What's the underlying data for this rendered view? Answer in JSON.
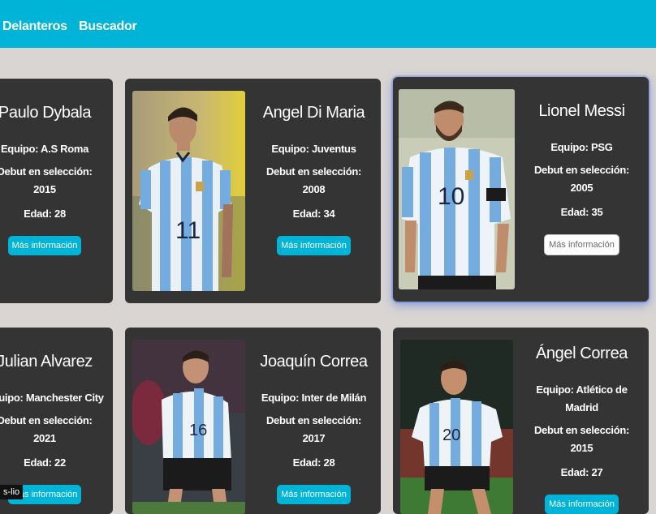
{
  "nav": {
    "links": [
      "Delanteros",
      "Buscador"
    ],
    "color": "#00b4d8"
  },
  "players": [
    {
      "name": "Paulo Dybala",
      "team": "Equipo: A.S Roma",
      "debut_label": "Debut en selección:",
      "debut_year": "2015",
      "age": "Edad: 28",
      "button": "Más información"
    },
    {
      "name": "Angel Di Maria",
      "team": "Equipo: Juventus",
      "debut_label": "Debut en selección:",
      "debut_year": "2008",
      "age": "Edad: 34",
      "button": "Más información"
    },
    {
      "name": "Lionel Messi",
      "team": "Equipo: PSG",
      "debut_label": "Debut en selección:",
      "debut_year": "2005",
      "age": "Edad: 35",
      "button": "Más información"
    },
    {
      "name": "Julian Alvarez",
      "team": "Equipo: Manchester City",
      "debut_label": "Debut en selección:",
      "debut_year": "2021",
      "age": "Edad: 22",
      "button": "Más información"
    },
    {
      "name": "Joaquín Correa",
      "team": "Equipo: Inter de Milán",
      "debut_label": "Debut en selección:",
      "debut_year": "2017",
      "age": "Edad: 28",
      "button": "Más información"
    },
    {
      "name": "Ángel Correa",
      "team_line1": "Equipo: Atlético de",
      "team_line2": "Madrid",
      "debut_label": "Debut en selección:",
      "debut_year": "2015",
      "age": "Edad: 27",
      "button": "Más información"
    }
  ],
  "jersey_numbers": [
    "11",
    "10",
    "16",
    "20"
  ],
  "corner_tip": "s-lio",
  "colors": {
    "background": "#d9d5d3",
    "card": "#343434",
    "accent": "#00b4d8"
  }
}
